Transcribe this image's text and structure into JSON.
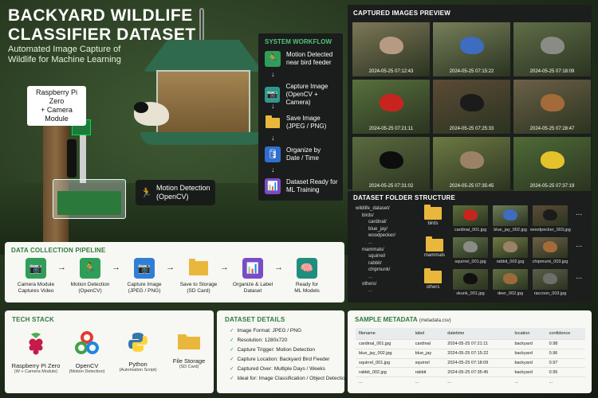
{
  "header": {
    "title_line1": "BACKYARD WILDLIFE",
    "title_line2": "CLASSIFIER DATASET",
    "subtitle": "Automated Image Capture of Wildlife for Machine Learning"
  },
  "scene_labels": {
    "raspberry_pi": "Raspberry Pi Zero\n+ Camera Module",
    "motion_detection_line1": "Motion Detection",
    "motion_detection_line2": "(OpenCV)"
  },
  "system_workflow": {
    "title": "SYSTEM WORKFLOW",
    "arrow": "↓",
    "steps": [
      {
        "label1": "Motion Detected",
        "label2": "near bird feeder",
        "color": "#2f9e58",
        "icon": "running-person-icon"
      },
      {
        "label1": "Capture Image",
        "label2": "(OpenCV + Camera)",
        "color": "#2c9a8a",
        "icon": "camera-icon"
      },
      {
        "label1": "Save Image",
        "label2": "(JPEG / PNG)",
        "color": "#e2a92a",
        "icon": "folder-icon"
      },
      {
        "label1": "Organize by",
        "label2": "Date / Time",
        "color": "#2f6fd1",
        "icon": "database-icon"
      },
      {
        "label1": "Dataset Ready for",
        "label2": "ML Training",
        "color": "#7a4cc9",
        "icon": "bar-chart-icon"
      }
    ]
  },
  "captured_images": {
    "title": "CAPTURED IMAGES PREVIEW",
    "items": [
      {
        "timestamp": "2024-05-25 07:12:43",
        "bg": "#7d7758",
        "subject": "#b69b82"
      },
      {
        "timestamp": "2024-05-25 07:15:22",
        "bg": "#76805a",
        "subject": "#3d6cc1"
      },
      {
        "timestamp": "2024-05-25 07:18:09",
        "bg": "#5f6e48",
        "subject": "#8b8b86"
      },
      {
        "timestamp": "2024-05-25 07:21:11",
        "bg": "#58703d",
        "subject": "#c8241f"
      },
      {
        "timestamp": "2024-05-25 07:25:33",
        "bg": "#5b4b36",
        "subject": "#1b1b1b"
      },
      {
        "timestamp": "2024-05-25 07:28:47",
        "bg": "#6c6046",
        "subject": "#a36b3a"
      },
      {
        "timestamp": "2024-05-25 07:31:02",
        "bg": "#5a6b3f",
        "subject": "#0d0d0d"
      },
      {
        "timestamp": "2024-05-25 07:35:45",
        "bg": "#6e7a44",
        "subject": "#9b8266"
      },
      {
        "timestamp": "2024-05-25 07:37:19",
        "bg": "#4f6b36",
        "subject": "#e3c22c"
      }
    ]
  },
  "dataset_folder": {
    "title": "DATASET FOLDER STRUCTURE",
    "tree": [
      "wildlife_dataset/",
      "birds/",
      "cardinal/",
      "blue_jay/",
      "woodpecker/",
      "...",
      "mammals/",
      "squirrel/",
      "rabbit/",
      "chipmunk/",
      "...",
      "others/",
      "..."
    ],
    "categories": [
      {
        "name": "birds",
        "files": [
          {
            "file": "cardinal_001.jpg",
            "bg": "#5c6e3b",
            "subject": "#c8241f"
          },
          {
            "file": "blue_jay_002.jpg",
            "bg": "#6c7c58",
            "subject": "#3d6cc1"
          },
          {
            "file": "woodpecker_003.jpg",
            "bg": "#5b4b36",
            "subject": "#1b1b1b"
          }
        ]
      },
      {
        "name": "mammals",
        "files": [
          {
            "file": "squirrel_001.jpg",
            "bg": "#5f6e48",
            "subject": "#8b8b86"
          },
          {
            "file": "rabbit_002.jpg",
            "bg": "#6e7a44",
            "subject": "#9b8266"
          },
          {
            "file": "chipmunk_003.jpg",
            "bg": "#6c6046",
            "subject": "#a36b3a"
          }
        ]
      },
      {
        "name": "others",
        "files": [
          {
            "file": "skunk_001.jpg",
            "bg": "#4f5c38",
            "subject": "#111111"
          },
          {
            "file": "deer_002.jpg",
            "bg": "#617043",
            "subject": "#9c6b3d"
          },
          {
            "file": "raccoon_003.jpg",
            "bg": "#595e48",
            "subject": "#6d6d6a"
          }
        ]
      }
    ],
    "more": "..."
  },
  "pipeline": {
    "title": "DATA COLLECTION PIPELINE",
    "arrow": "→",
    "steps": [
      {
        "label1": "Camera Module",
        "label2": "Captures Video",
        "color": "#2f9e58",
        "icon": "camera-icon"
      },
      {
        "label1": "Motion Detection",
        "label2": "(OpenCV)",
        "color": "#2f9e58",
        "icon": "running-person-icon"
      },
      {
        "label1": "Capture Image",
        "label2": "(JPEG / PNG)",
        "color": "#2f7ed8",
        "icon": "camera-icon"
      },
      {
        "label1": "Save to Storage",
        "label2": "(SD Card)",
        "color": "#e2a92a",
        "icon": "folder-icon"
      },
      {
        "label1": "Organize & Label",
        "label2": "Dataset",
        "color": "#7a4cc9",
        "icon": "bar-chart-icon"
      },
      {
        "label1": "Ready for",
        "label2": "ML Models",
        "color": "#1e8f7c",
        "icon": "brain-icon"
      }
    ]
  },
  "tech_stack": {
    "title": "TECH STACK",
    "items": [
      {
        "name": "Raspberry Pi Zero",
        "sub": "(W + Camera Module)",
        "icon": "raspberry-icon"
      },
      {
        "name": "OpenCV",
        "sub": "(Motion Detection)",
        "icon": "opencv-icon"
      },
      {
        "name": "Python",
        "sub": "(Automation Script)",
        "icon": "python-icon"
      },
      {
        "name": "File Storage",
        "sub": "(SD Card)",
        "icon": "folder-icon"
      }
    ]
  },
  "dataset_details": {
    "title": "DATASET DETAILS",
    "items": [
      "Image Format: JPEG / PNG",
      "Resolution: 1280x720",
      "Capture Trigger: Motion Detection",
      "Capture Location: Backyard Bird Feeder",
      "Captured Over: Multiple Days / Weeks",
      "Ideal for: Image Classification / Object Detection"
    ]
  },
  "sample_metadata": {
    "title": "SAMPLE METADATA",
    "subtitle": "(metadata.csv)",
    "columns": [
      "filename",
      "label",
      "datetime",
      "location",
      "confidence"
    ],
    "rows": [
      [
        "cardinal_001.jpg",
        "cardinal",
        "2024-05-25 07:21:11",
        "backyard",
        "0.98"
      ],
      [
        "blue_jay_002.jpg",
        "blue_jay",
        "2024-05-25 07:15:22",
        "backyard",
        "0.96"
      ],
      [
        "squirrel_001.jpg",
        "squirrel",
        "2024-05-25 07:18:09",
        "backyard",
        "0.97"
      ],
      [
        "rabbit_002.jpg",
        "rabbit",
        "2024-05-25 07:35:45",
        "backyard",
        "0.95"
      ],
      [
        "...",
        "...",
        "...",
        "...",
        "..."
      ]
    ]
  }
}
